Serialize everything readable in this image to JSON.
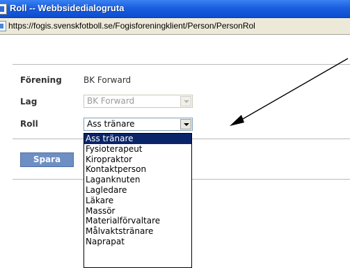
{
  "window": {
    "title": "Roll -- Webbsidedialogruta",
    "url": "https://fogis.svenskfotboll.se/Fogisforeningklient/Person/PersonRol"
  },
  "form": {
    "forening_label": "Förening",
    "forening_value": "BK Forward",
    "lag_label": "Lag",
    "lag_value": "BK Forward",
    "roll_label": "Roll",
    "roll_value": "Ass tränare",
    "save_label": "Spara"
  },
  "roll_options": [
    "Ass tränare",
    "Fysioterapeut",
    "Kiropraktor",
    "Kontaktperson",
    "Laganknuten",
    "Lagledare",
    "Läkare",
    "Massör",
    "Materialförvaltare",
    "Målvaktstränare",
    "Naprapat"
  ],
  "colors": {
    "titlebar": "#1b5fe0",
    "save_button": "#6e8fc4",
    "selected_option": "#0a246a"
  },
  "icons": {
    "window": "window-icon",
    "page": "page-icon",
    "dropdown_arrow": "chevron-down-icon"
  }
}
